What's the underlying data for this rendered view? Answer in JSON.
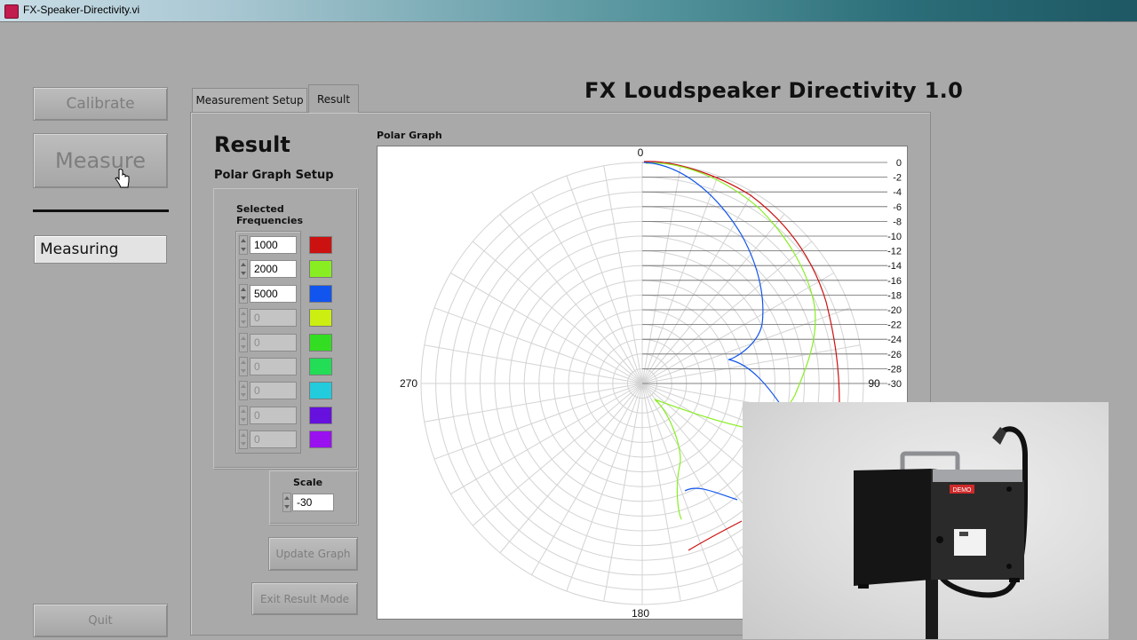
{
  "window": {
    "title": "FX-Speaker-Directivity.vi"
  },
  "app_title": "FX Loudspeaker Directivity 1.0",
  "left_panel": {
    "calibrate_label": "Calibrate",
    "measure_label": "Measure",
    "status_value": "Measuring",
    "quit_label": "Quit"
  },
  "tabs": [
    {
      "label": "Measurement Setup",
      "active": false
    },
    {
      "label": "Result",
      "active": true
    }
  ],
  "result_tab": {
    "heading": "Result",
    "polar_setup_label": "Polar Graph Setup",
    "selected_frequencies_label": "Selected\nFrequencies",
    "frequencies": [
      {
        "value": "1000",
        "enabled": true,
        "color": "#cc1111"
      },
      {
        "value": "2000",
        "enabled": true,
        "color": "#88ee22"
      },
      {
        "value": "5000",
        "enabled": true,
        "color": "#1155ee"
      },
      {
        "value": "0",
        "enabled": false,
        "color": "#ccee11"
      },
      {
        "value": "0",
        "enabled": false,
        "color": "#33dd22"
      },
      {
        "value": "0",
        "enabled": false,
        "color": "#22dd55"
      },
      {
        "value": "0",
        "enabled": false,
        "color": "#22ccdd"
      },
      {
        "value": "0",
        "enabled": false,
        "color": "#6611dd"
      },
      {
        "value": "0",
        "enabled": false,
        "color": "#9911ee"
      }
    ],
    "scale_label": "Scale",
    "scale_value": "-30",
    "update_graph_label": "Update Graph",
    "exit_result_label": "Exit Result Mode"
  },
  "polar_graph": {
    "label": "Polar Graph",
    "angle_labels": [
      "0",
      "90",
      "180",
      "270"
    ],
    "radial_labels": [
      "0",
      "-2",
      "-4",
      "-6",
      "-8",
      "-10",
      "-12",
      "-14",
      "-16",
      "-18",
      "-20",
      "-22",
      "-24",
      "-26",
      "-28",
      "-30"
    ],
    "scale_min_db": -30,
    "series_colors": {
      "1000": "#cc1111",
      "2000": "#88ee22",
      "5000": "#1155ee"
    }
  },
  "video_overlay": {
    "badge_text": "DEMO"
  }
}
